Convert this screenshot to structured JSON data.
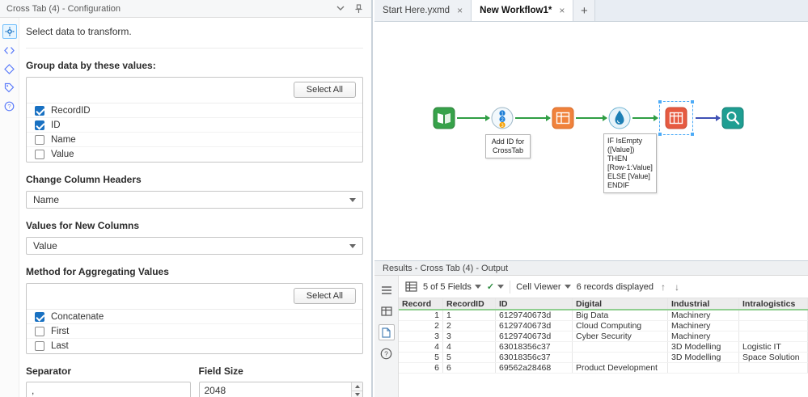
{
  "config": {
    "title": "Cross Tab (4) - Configuration",
    "intro": "Select data to transform.",
    "group": {
      "label": "Group data by these values:",
      "select_all": "Select All",
      "items": [
        {
          "label": "RecordID",
          "checked": true
        },
        {
          "label": "ID",
          "checked": true
        },
        {
          "label": "Name",
          "checked": false
        },
        {
          "label": "Value",
          "checked": false
        }
      ]
    },
    "column_headers": {
      "label": "Change Column Headers",
      "value": "Name"
    },
    "new_columns": {
      "label": "Values for New Columns",
      "value": "Value"
    },
    "aggregation": {
      "label": "Method for Aggregating Values",
      "select_all": "Select All",
      "items": [
        {
          "label": "Concatenate",
          "checked": true
        },
        {
          "label": "First",
          "checked": false
        },
        {
          "label": "Last",
          "checked": false
        }
      ]
    },
    "separator": {
      "label": "Separator",
      "value": ","
    },
    "field_size": {
      "label": "Field Size",
      "value": "2048"
    }
  },
  "tabs": {
    "items": [
      {
        "label": "Start Here.yxmd",
        "active": false
      },
      {
        "label": "New Workflow1*",
        "active": true
      }
    ],
    "close_glyph": "×",
    "add_glyph": "+"
  },
  "canvas": {
    "annotation_recordid": "Add ID for\nCrossTab",
    "annotation_formula": "IF IsEmpty\n([Value]) THEN\n[Row-1:Value]\nELSE [Value]\nENDIF"
  },
  "results": {
    "title": "Results - Cross Tab (4) - Output",
    "fields": "5 of 5 Fields",
    "check_glyph": "✓",
    "cell_viewer": "Cell Viewer",
    "records": "6 records displayed",
    "up_glyph": "↑",
    "down_glyph": "↓",
    "table": {
      "columns": [
        "Record",
        "RecordID",
        "ID",
        "Digital",
        "Industrial",
        "Intralogistics"
      ],
      "rows": [
        [
          "1",
          "1",
          "6129740673d",
          "Big Data",
          "Machinery",
          ""
        ],
        [
          "2",
          "2",
          "6129740673d",
          "Cloud Computing",
          "Machinery",
          ""
        ],
        [
          "3",
          "3",
          "6129740673d",
          "Cyber Security",
          "Machinery",
          ""
        ],
        [
          "4",
          "4",
          "63018356c37",
          "",
          "3D Modelling",
          "Logistic IT"
        ],
        [
          "5",
          "5",
          "63018356c37",
          "",
          "3D Modelling",
          "Space Solution"
        ],
        [
          "6",
          "6",
          "69562a28468",
          "Product Development",
          "",
          ""
        ]
      ]
    }
  }
}
